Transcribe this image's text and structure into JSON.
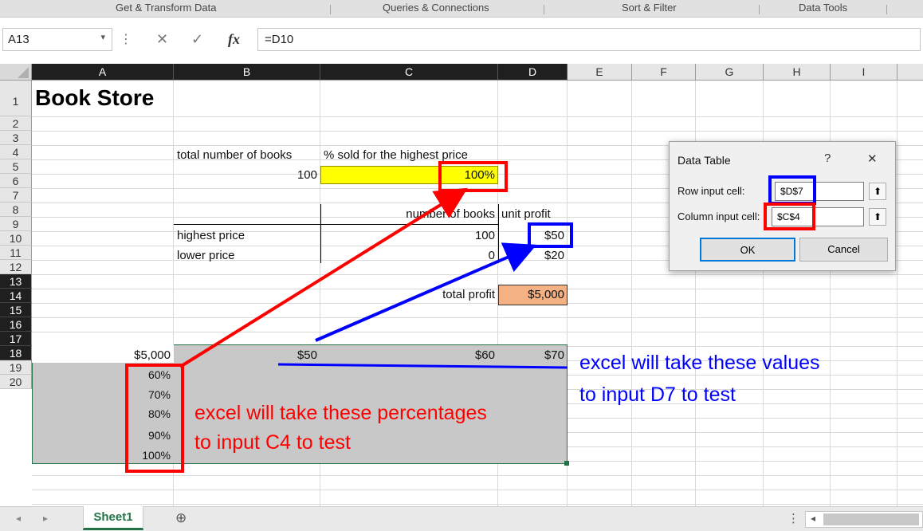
{
  "ribbon": {
    "groups": [
      "Get & Transform Data",
      "Queries & Connections",
      "Sort & Filter",
      "Data Tools"
    ]
  },
  "formula_bar": {
    "name_box": "A13",
    "cancel_icon": "✕",
    "enter_icon": "✓",
    "fx_label": "fx",
    "formula": "=D10"
  },
  "columns": [
    "A",
    "B",
    "C",
    "D",
    "E",
    "F",
    "G",
    "H",
    "I"
  ],
  "rows": [
    "1",
    "2",
    "3",
    "4",
    "5",
    "6",
    "7",
    "8",
    "9",
    "10",
    "11",
    "12",
    "13",
    "14",
    "15",
    "16",
    "17",
    "18",
    "19",
    "20"
  ],
  "cells": {
    "a1": "Book Store",
    "b3": "total number of books",
    "c3": "% sold for the highest price",
    "b4": "100",
    "c4": "100%",
    "c6": "number of books",
    "d6": "unit profit",
    "b7": "highest price",
    "c7": "100",
    "d7": "$50",
    "b8": "lower price",
    "c8": "0",
    "d8": "$20",
    "c10": "total profit",
    "d10": "$5,000",
    "a13": "$5,000",
    "b13": "$50",
    "c13": "$60",
    "d13": "$70",
    "a14": "60%",
    "a15": "70%",
    "a16": "80%",
    "a17": "90%",
    "a18": "100%"
  },
  "dialog": {
    "title": "Data Table",
    "help": "?",
    "close": "✕",
    "row_label": "Row input cell:",
    "row_value": "$D$7",
    "col_label": "Column input cell:",
    "col_value": "$C$4",
    "ok": "OK",
    "cancel": "Cancel"
  },
  "annotations": {
    "blue_line1": "excel will take these values",
    "blue_line2": "to input D7 to test",
    "red_line1": "excel will take these percentages",
    "red_line2": "to input C4 to test"
  },
  "tabs": {
    "sheet": "Sheet1",
    "add": "⊕"
  },
  "colors": {
    "yellow_fill": "#ffff00",
    "orange_fill": "#f4b183",
    "table_fill": "#c8c8c8",
    "annotation_red": "#ff0000",
    "annotation_blue": "#0000ff",
    "excel_green": "#217346"
  }
}
